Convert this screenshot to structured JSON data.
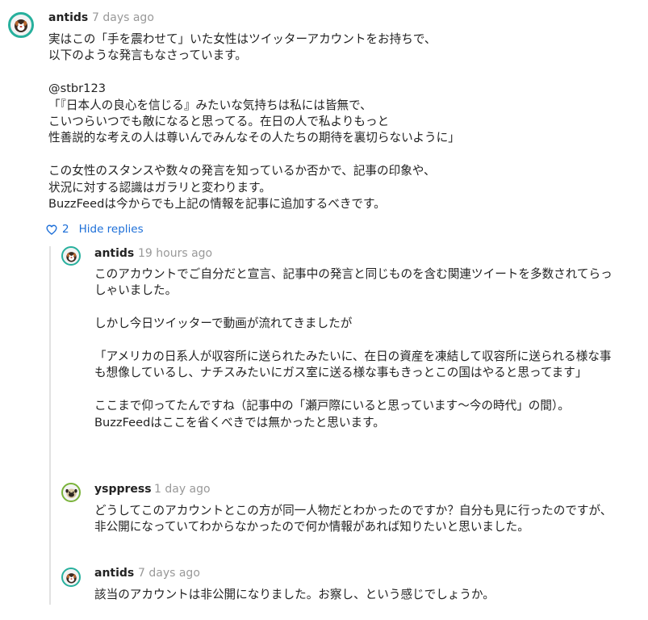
{
  "comments": [
    {
      "username": "antids",
      "timestamp": "7 days ago",
      "avatar_icon": "dog-avatar-icon",
      "body": "実はこの「手を震わせて」いた女性はツイッターアカウントをお持ちで、\n以下のような発言もなさっています。\n\n@stbr123\n「『日本人の良心を信じる』みたいな気持ちは私には皆無で、\nこいつらいつでも敵になると思ってる。在日の人で私よりもっと\n性善説的な考えの人は尊いんでみんなその人たちの期待を裏切らないように」\n\nこの女性のスタンスや数々の発言を知っているか否かで、記事の印象や、\n状況に対する認識はガラリと変わります。\nBuzzFeedは今からでも上記の情報を記事に追加するべきです。",
      "like_count": "2",
      "hide_replies_label": "Hide replies"
    }
  ],
  "replies": [
    {
      "username": "antids",
      "timestamp": "19 hours ago",
      "avatar_icon": "dog-avatar-icon",
      "body": "このアカウントでご自分だと宣言、記事中の発言と同じものを含む関連ツイートを多数されてらっしゃいました。\n\nしかし今日ツイッターで動画が流れてきましたが\n\n「アメリカの日系人が収容所に送られたみたいに、在日の資産を凍結して収容所に送られる様な事も想像しているし、ナチスみたいにガス室に送る様な事もきっとこの国はやると思ってます」\n\nここまで仰ってたんですね（記事中の「瀬戸際にいると思っています～今の時代」の間）。\nBuzzFeedはここを省くべきでは無かったと思います。"
    },
    {
      "username": "ysppress",
      "timestamp": "1 day ago",
      "avatar_icon": "pug-avatar-icon",
      "body": "どうしてこのアカウントとこの方が同一人物だとわかったのですか？自分も見に行ったのですが、非公開になっていてわからなかったので何か情報があれば知りたいと思いました。"
    },
    {
      "username": "antids",
      "timestamp": "7 days ago",
      "avatar_icon": "dog-avatar-icon",
      "body": "該当のアカウントは非公開になりました。お察し、という感じでしょうか。"
    }
  ],
  "colors": {
    "link": "#1d6fd8",
    "timestamp": "#999999",
    "dog_avatar_ring": "#27b09d",
    "pug_avatar_ring": "#7ab33a",
    "thread_line": "#e2e2e2"
  }
}
